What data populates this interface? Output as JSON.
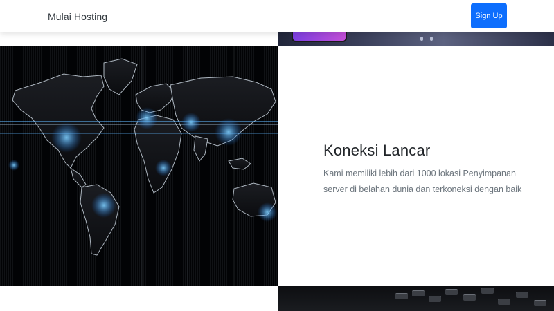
{
  "navbar": {
    "brand": "Mulai Hosting",
    "signup_label": "Sign Up"
  },
  "feature": {
    "title": "Koneksi Lancar",
    "description": "Kami memiliki lebih dari 1000 lokasi Penyimpanan server di belahan dunia dan terkoneksi dengan baik"
  },
  "colors": {
    "primary": "#0d6efd",
    "map_background": "#020305",
    "map_glow": "#2a9cff"
  },
  "images": {
    "world_map": "world-map-image",
    "top_strip": "phone-device-image",
    "bottom_strip": "keyboard-image"
  }
}
